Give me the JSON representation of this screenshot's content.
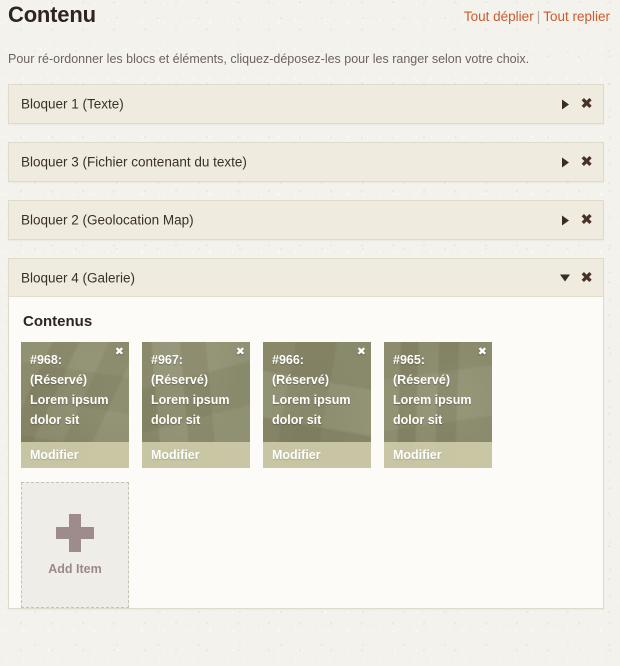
{
  "header": {
    "title": "Contenu",
    "expand_all_label": "Tout déplier",
    "separator": "|",
    "collapse_all_label": "Tout replier",
    "link_color": "#cf5a2c"
  },
  "intro": "Pour ré-ordonner les blocs et éléments, cliquez-déposez-les pour les ranger selon votre choix.",
  "icons": {
    "collapsed_toggle": "triangle-right-icon",
    "expanded_toggle": "triangle-down-icon",
    "remove": "close-icon",
    "add": "plus-icon"
  },
  "blocks": [
    {
      "title": "Bloquer 1 (Texte)",
      "state": "collapsed",
      "close_label": "✖"
    },
    {
      "title": "Bloquer 3 (Fichier contenant du texte)",
      "state": "collapsed",
      "close_label": "✖"
    },
    {
      "title": "Bloquer 2 (Geolocation Map)",
      "state": "collapsed",
      "close_label": "✖"
    },
    {
      "title": "Bloquer 4 (Galerie)",
      "state": "expanded",
      "close_label": "✖",
      "body_title": "Contenus",
      "items": [
        {
          "id": "#968:",
          "reserved": "(Réservé)",
          "line1": "Lorem ipsum",
          "line2": "dolor sit",
          "edit_label": "Modifier",
          "close_label": "✖"
        },
        {
          "id": "#967:",
          "reserved": "(Réservé)",
          "line1": "Lorem ipsum",
          "line2": "dolor sit",
          "edit_label": "Modifier",
          "close_label": "✖"
        },
        {
          "id": "#966:",
          "reserved": "(Réservé)",
          "line1": "Lorem ipsum",
          "line2": "dolor sit",
          "edit_label": "Modifier",
          "close_label": "✖"
        },
        {
          "id": "#965:",
          "reserved": "(Réservé)",
          "line1": "Lorem ipsum",
          "line2": "dolor sit",
          "edit_label": "Modifier",
          "close_label": "✖"
        }
      ],
      "add_item_label": "Add Item"
    }
  ],
  "colors": {
    "page_background": "#f3f2ed",
    "block_header": "#efebdf",
    "block_body": "#fcfbf8",
    "block_border": "#dedbcd",
    "item_overlay": "#8c8c6c",
    "item_footer": "#cdcba8",
    "plus": "#9e8b8b"
  }
}
